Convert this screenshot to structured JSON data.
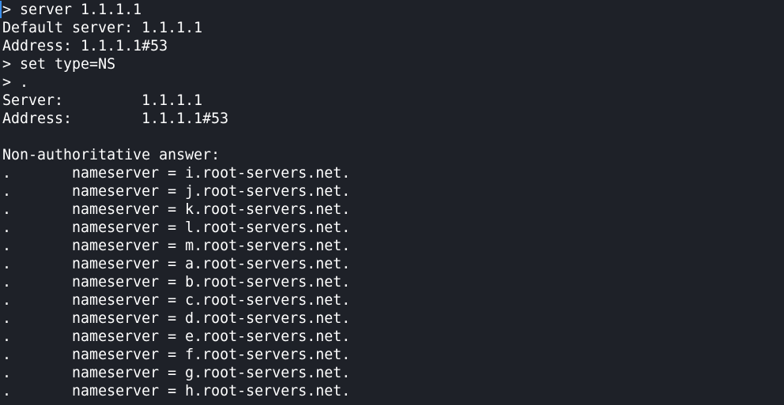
{
  "terminal": {
    "lines": [
      "> server 1.1.1.1",
      "Default server: 1.1.1.1",
      "Address: 1.1.1.1#53",
      "> set type=NS",
      "> .",
      "Server:         1.1.1.1",
      "Address:        1.1.1.1#53",
      "",
      "Non-authoritative answer:",
      ".       nameserver = i.root-servers.net.",
      ".       nameserver = j.root-servers.net.",
      ".       nameserver = k.root-servers.net.",
      ".       nameserver = l.root-servers.net.",
      ".       nameserver = m.root-servers.net.",
      ".       nameserver = a.root-servers.net.",
      ".       nameserver = b.root-servers.net.",
      ".       nameserver = c.root-servers.net.",
      ".       nameserver = d.root-servers.net.",
      ".       nameserver = e.root-servers.net.",
      ".       nameserver = f.root-servers.net.",
      ".       nameserver = g.root-servers.net.",
      ".       nameserver = h.root-servers.net."
    ],
    "colors": {
      "background": "#1e2128",
      "foreground": "#ffffff",
      "marker": "#3b8eea"
    }
  }
}
